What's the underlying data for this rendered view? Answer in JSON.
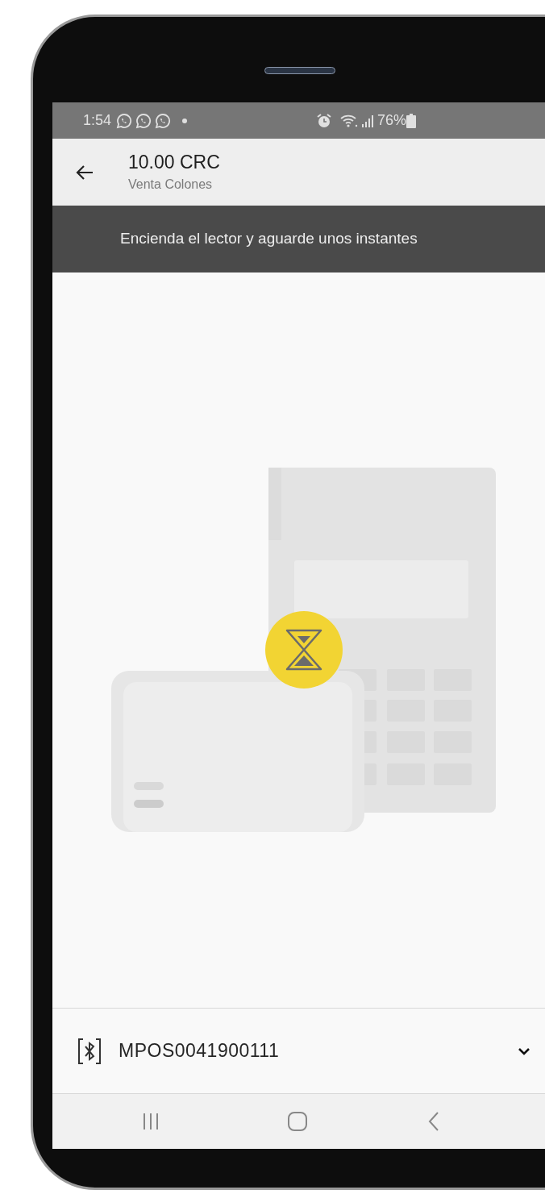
{
  "status_bar": {
    "time": "1:54",
    "battery": "76%"
  },
  "app_bar": {
    "title": "10.00 CRC",
    "subtitle": "Venta Colones"
  },
  "banner": {
    "text": "Encienda el lector y aguarde unos instantes"
  },
  "device_selector": {
    "name": "MPOS0041900111"
  }
}
